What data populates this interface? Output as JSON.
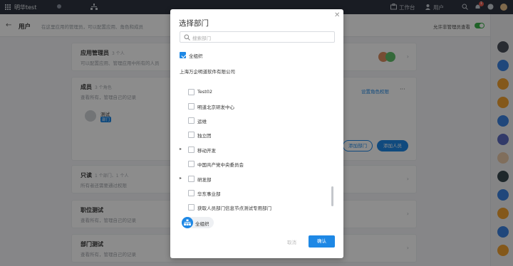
{
  "topbar": {
    "org_name": "明华test",
    "nav_workbench": "工作台",
    "nav_users": "用户",
    "notification_count": "1"
  },
  "subbar": {
    "title": "用户",
    "description": "在这里应用的管理员，可以配置应用、角色和成员",
    "toggle_label": "允许非管理员查看"
  },
  "cards": [
    {
      "title": "应用管理员",
      "count": "3 个人",
      "desc": "可以配置应用、管理应用中所有的人员"
    },
    {
      "title": "成员",
      "count": "3 个角色",
      "desc": "查看所有，管理自己的记录",
      "member_name": "测试",
      "member_tag": "部门"
    },
    {
      "title": "只读",
      "count": "1 个部门、1 个人",
      "desc": "所有者还需要通过权限"
    },
    {
      "title": "职位测试",
      "count": "",
      "desc": "查看所有，管理自己的记录"
    },
    {
      "title": "部门测试",
      "count": "",
      "desc": "查看所有，管理自己的记录"
    }
  ],
  "card_links": {
    "set_role_perm": "设置角色权限",
    "add_dept": "添加部门",
    "add_person": "添加人员"
  },
  "modal": {
    "title": "选择部门",
    "search_placeholder": "搜索部门",
    "all_org": "全组织",
    "company": "上海万企明道软件有限公司",
    "departments": [
      "Test02",
      "明道北京研发中心",
      "运维",
      "独立团",
      "移动开发",
      "中国共产党中央委员会",
      "研发部",
      "华东事业部",
      "获取人员部门信息节点测试专用部门"
    ],
    "selected_chip": "全组织",
    "cancel": "取消",
    "confirm": "确认"
  },
  "colors": {
    "primary": "#1e88e5",
    "topbar": "#2e3440",
    "toggle_on": "#3bb34a"
  }
}
